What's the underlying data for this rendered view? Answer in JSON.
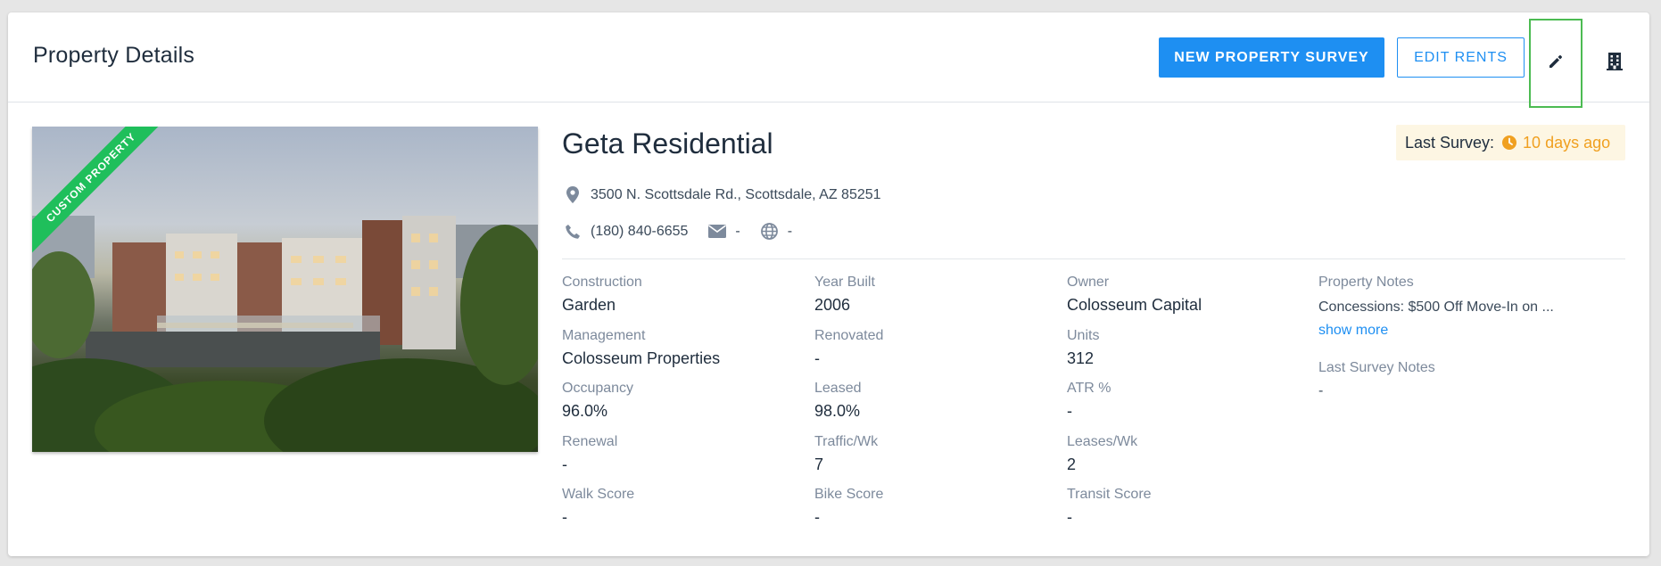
{
  "header": {
    "title": "Property Details",
    "new_survey_label": "NEW PROPERTY SURVEY",
    "edit_rents_label": "EDIT RENTS"
  },
  "colors": {
    "primary": "#1e8ff2",
    "ribbon": "#1fbf5b",
    "survey_accent": "#f0a020",
    "highlight_border": "#4cbb52"
  },
  "property": {
    "ribbon_label": "CUSTOM PROPERTY",
    "name": "Geta Residential",
    "address": "3500 N. Scottsdale Rd., Scottsdale, AZ 85251",
    "phone": "(180) 840-6655",
    "email": "-",
    "website": "-",
    "last_survey_label": "Last Survey:",
    "last_survey_value": "10 days ago"
  },
  "details": {
    "construction": {
      "label": "Construction",
      "value": "Garden"
    },
    "year_built": {
      "label": "Year Built",
      "value": "2006"
    },
    "owner": {
      "label": "Owner",
      "value": "Colosseum Capital"
    },
    "management": {
      "label": "Management",
      "value": "Colosseum Properties"
    },
    "renovated": {
      "label": "Renovated",
      "value": "-"
    },
    "units": {
      "label": "Units",
      "value": "312"
    },
    "occupancy": {
      "label": "Occupancy",
      "value": "96.0%"
    },
    "leased": {
      "label": "Leased",
      "value": "98.0%"
    },
    "atr": {
      "label": "ATR %",
      "value": "-"
    },
    "renewal": {
      "label": "Renewal",
      "value": "-"
    },
    "traffic": {
      "label": "Traffic/Wk",
      "value": "7"
    },
    "leases": {
      "label": "Leases/Wk",
      "value": "2"
    },
    "walk_score": {
      "label": "Walk Score",
      "value": "-"
    },
    "bike_score": {
      "label": "Bike Score",
      "value": "-"
    },
    "transit_score": {
      "label": "Transit Score",
      "value": "-"
    }
  },
  "notes": {
    "property_notes_label": "Property Notes",
    "property_notes_text": "Concessions: $500 Off Move-In on ...",
    "show_more": "show more",
    "last_survey_notes_label": "Last Survey Notes",
    "last_survey_notes_text": "-"
  },
  "icons": {
    "edit": "pencil-icon",
    "building": "building-icon",
    "location": "map-pin-icon",
    "phone": "phone-icon",
    "email": "envelope-icon",
    "website": "globe-icon",
    "clock": "clock-icon"
  }
}
